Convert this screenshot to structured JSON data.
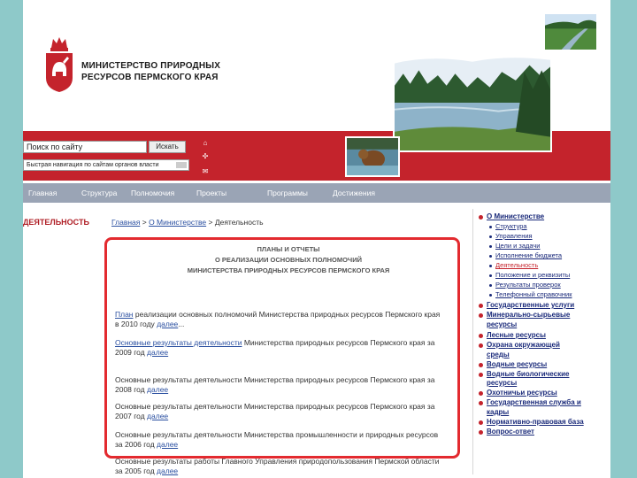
{
  "header": {
    "ministry_line1": "МИНИСТЕРСТВО ПРИРОДНЫХ",
    "ministry_line2": "РЕСУРСОВ ПЕРМСКОГО КРАЯ",
    "search_value": "Поиск по сайту",
    "search_button": "Искать",
    "region_select": "Быстрая навигация по сайтам органов власти"
  },
  "nav": [
    "Главная",
    "Структура",
    "Полномочия",
    "Проекты",
    "Программы",
    "Достижения"
  ],
  "left_title": "ДЕЯТЕЛЬНОСТЬ",
  "breadcrumb": {
    "home": "Главная",
    "sep1": ">",
    "about": "О Министерстве",
    "sep2": ">",
    "current": "Деятельность"
  },
  "content": {
    "heading_lines": [
      "ПЛАНЫ И ОТЧЕТЫ",
      "О РЕАЛИЗАЦИИ ОСНОВНЫХ ПОЛНОМОЧИЙ",
      "МИНИСТЕРСТВА ПРИРОДНЫХ РЕСУРСОВ ПЕРМСКОГО КРАЯ"
    ],
    "items": [
      {
        "link": "План",
        "text": " реализации основных полномочий Министерства природных ресурсов Пермского края",
        "line2": "в 2010 году ",
        "more": "далее",
        "tail": "..."
      },
      {
        "link": "Основные результаты деятельности",
        "text": " Министерства природных ресурсов Пермского края за",
        "line2": "2009 год ",
        "more": "далее",
        "tail": ""
      },
      {
        "link": "",
        "text": "Основные результаты деятельности Министерства природных ресурсов Пермского края за",
        "line2": "2008 год ",
        "more": "далее",
        "tail": ""
      },
      {
        "link": "",
        "text": "Основные результаты деятельности Министерства природных ресурсов Пермского края за",
        "line2": "2007 год ",
        "more": "далее",
        "tail": ""
      },
      {
        "link": "",
        "text": "Основные результаты деятельности Министерства промышленности и природных ресурсов",
        "line2": "за 2006 год ",
        "more": "далее",
        "tail": ""
      },
      {
        "link": "",
        "text": "Основные результаты работы Главного Управления природопользования Пермской области",
        "line2": "за 2005 год ",
        "more": "далее",
        "tail": ""
      }
    ]
  },
  "sidebar": {
    "about": "О Министерстве",
    "sub": [
      "Структура",
      "Управления",
      "Цели и задачи",
      "Исполнение бюджета",
      "Деятельность",
      "Положение и реквизиты",
      "Результаты проверок",
      "Телефонный справочник"
    ],
    "main": [
      "Государственные услуги",
      "Минерально-сырьевые",
      "ресурсы",
      "Лесные ресурсы",
      "Охрана окружающей",
      "среды",
      "Водные ресурсы",
      "Водные биологические",
      "ресурсы",
      "Охотничьи ресурсы",
      "Государственная служба и",
      "кадры",
      "Нормативно-правовая база",
      "Вопрос-ответ"
    ]
  },
  "colors": {
    "brand_red": "#c4232c",
    "highlight": "#e32a2f",
    "nav_bar": "#9aa4b5",
    "link": "#2a4fa0"
  }
}
